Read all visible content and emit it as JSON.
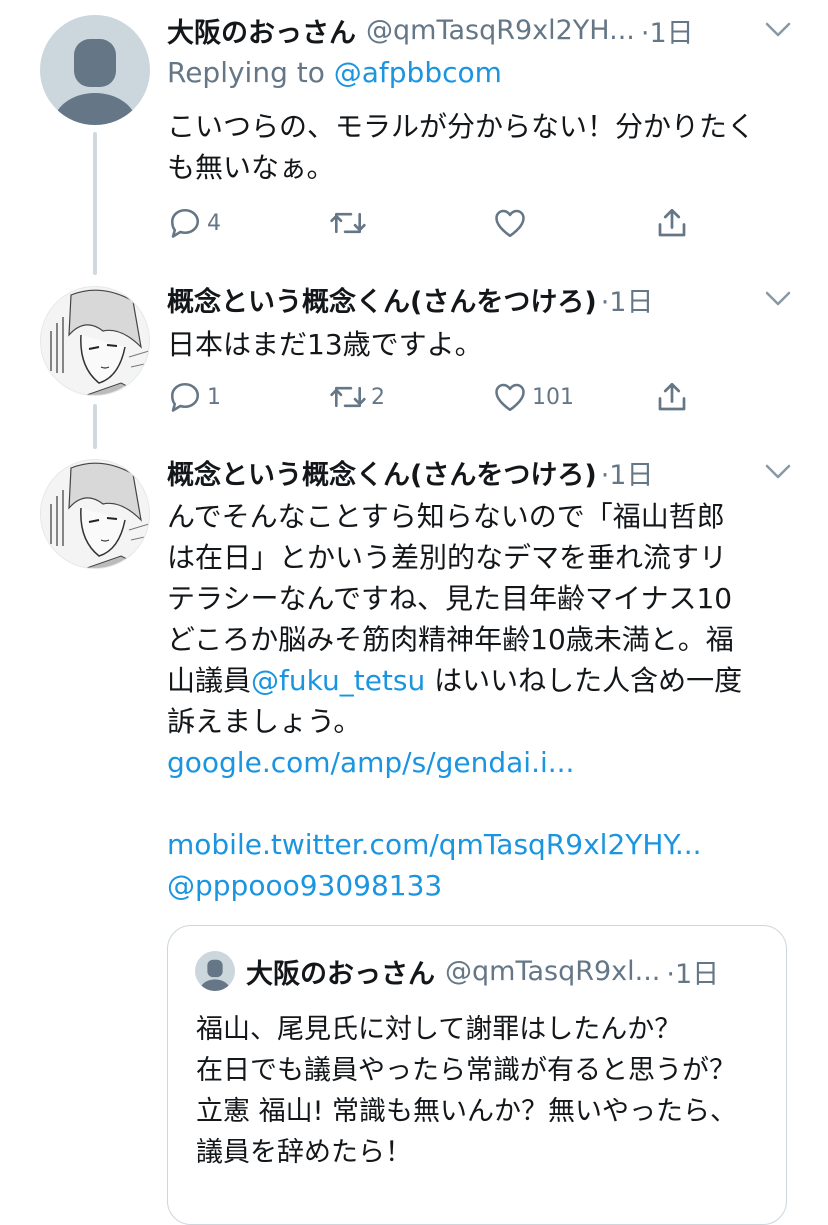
{
  "tweets": [
    {
      "name": "大阪のおっさん",
      "handle": "@qmTasqR9xl2YH...",
      "time": "·1日",
      "replying_prefix": "Replying to ",
      "replying_to": "@afpbbcom",
      "text": "こいつらの、モラルが分からない！分かりたくも無いなぁ。",
      "counts": {
        "reply": "4",
        "retweet": "",
        "like": ""
      }
    },
    {
      "name": "概念という概念くん(さんをつけろ)",
      "time": "·1日",
      "text": "日本はまだ13歳ですよ。",
      "counts": {
        "reply": "1",
        "retweet": "2",
        "like": "101"
      }
    },
    {
      "name": "概念という概念くん(さんをつけろ)",
      "time": "·1日",
      "lines": [
        "んでそんなことすら知らないので「福山哲郎",
        "は在日」とかいう差別的なデマを垂れ流すリ",
        "テラシーなんですね、見た目年齢マイナス10",
        "どころか脳みそ筋肉精神年齢10歳未満と。福"
      ],
      "line5_prefix": "山議員",
      "mention": "@fuku_tetsu",
      "line5_suffix": " はいいねした人含め一度",
      "line6": "訴えましょう。",
      "link1": "google.com/amp/s/gendai.i...",
      "link2": "mobile.twitter.com/qmTasqR9xl2YHY...",
      "link3": "@pppooo93098133"
    }
  ],
  "quote": {
    "name": "大阪のおっさん",
    "handle": "@qmTasqR9xl...",
    "time": "·1日",
    "text": "福山、尾見氏に対して謝罪はしたんか？\n在日でも議員やったら常識が有ると思うが？\n立憲 福山! 常識も無いんか？無いやったら、議員を辞めたら！"
  },
  "colors": {
    "accent": "#1b95e0",
    "secondary": "#657786",
    "text": "#14171a",
    "border": "#ccd6dd"
  },
  "icons": [
    "reply-icon",
    "retweet-icon",
    "like-icon",
    "share-icon",
    "chevron-down-icon"
  ]
}
